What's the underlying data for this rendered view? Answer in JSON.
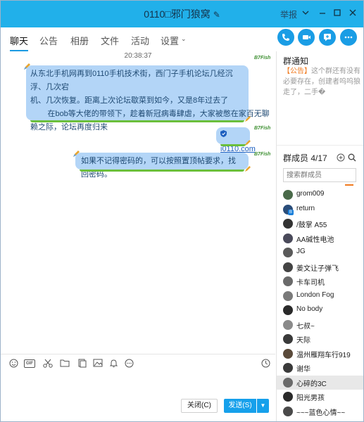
{
  "window": {
    "title": "0110□邪门狼窝",
    "report_label": "举报"
  },
  "tabs": [
    {
      "label": "聊天"
    },
    {
      "label": "公告"
    },
    {
      "label": "相册"
    },
    {
      "label": "文件"
    },
    {
      "label": "活动"
    },
    {
      "label": "设置"
    }
  ],
  "chat": {
    "timestamp": "20:38:37",
    "messages": [
      {
        "lines": [
          "从东北手机网再到0110手机技术街，西门子手机论坛几经沉浮、几次宕",
          "机、几次恢复。距离上次论坛歇菜到如今，又是8年过去了",
          "        在bob等大佬的带领下，趁着新冠病毒肆虐，大家被憋在家百无聊",
          "赖之际，论坛再度归来"
        ]
      },
      {
        "link": "i0110.com"
      },
      {
        "lines": [
          "如果不记得密码的，可以按照置顶帖要求，找回密码。"
        ]
      }
    ],
    "logo_text": "B7Fish"
  },
  "notice": {
    "title": "群通知",
    "tag": "【公告】",
    "text": "这个群还有没有必要存在，创建者呜呜狼走了，二手�"
  },
  "members": {
    "title": "群成员 4/17",
    "search_placeholder": "搜索群成员",
    "list": [
      {
        "name": "grom009",
        "color": "#4a6a4a"
      },
      {
        "name": "return",
        "color": "#2a4d7a",
        "badge": "B"
      },
      {
        "name": "/鼓掌 A55",
        "color": "#333333"
      },
      {
        "name": "AA碱性电池",
        "color": "#4a4a5a"
      },
      {
        "name": "JG",
        "color": "#5a5a5a"
      },
      {
        "name": "姜文让子弹飞",
        "color": "#444444"
      },
      {
        "name": "卡车司机",
        "color": "#6a6a6a"
      },
      {
        "name": "London Fog",
        "color": "#7a7a7a"
      },
      {
        "name": "No body",
        "color": "#2a2a2a"
      },
      {
        "name": "七叔~",
        "color": "#8a8a8a"
      },
      {
        "name": "天际",
        "color": "#3a3a3a"
      },
      {
        "name": "温州雁翔车行919",
        "color": "#5a4a3a"
      },
      {
        "name": "谢华",
        "color": "#3a3a3a"
      },
      {
        "name": "心碎的3C",
        "color": "#6a6a6a"
      },
      {
        "name": "阳光男孩",
        "color": "#2a2a2a"
      },
      {
        "name": "~~~蓝色心情~~",
        "color": "#4a4a4a"
      }
    ],
    "selected_index": 13
  },
  "toolbar": {
    "gif_label": "GIF"
  },
  "buttons": {
    "close_label": "关闭(C)",
    "send_label": "发送(S)"
  },
  "colors": {
    "titlebar": "#21b0ea",
    "bubble": "#b3d5f7",
    "accent": "#1a9de5"
  }
}
